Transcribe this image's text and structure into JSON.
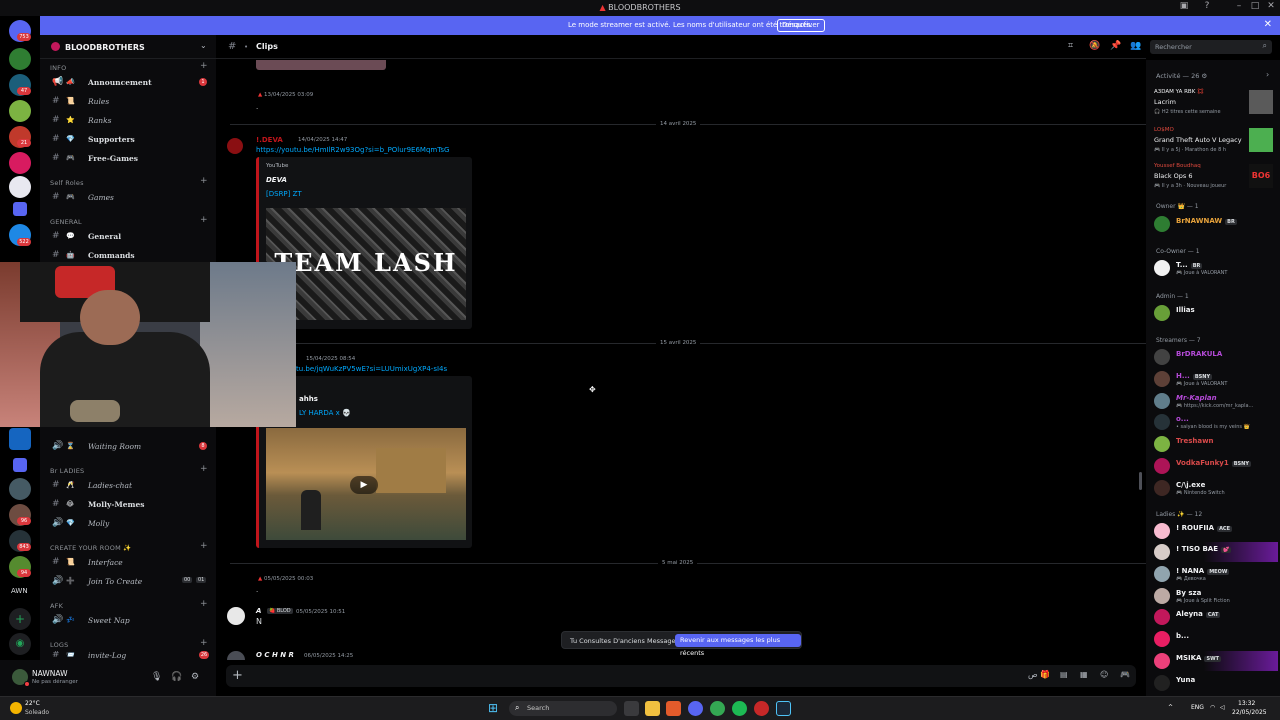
{
  "window": {
    "title": "BLOODBROTHERS"
  },
  "banner": {
    "text": "Le mode streamer est activé. Les noms d'utilisateur ont été tronqués.",
    "button": "Désactiver"
  },
  "rail": {
    "badges": [
      "753",
      "47",
      "21",
      "522",
      "96",
      "843",
      "94"
    ],
    "bottom_label": "AWN"
  },
  "server": {
    "name": "BLOODBROTHERS"
  },
  "sidebar": {
    "categories": {
      "info": "INFO",
      "self_roles": "Self Roles",
      "general": "GENERAL",
      "br_ladies": "Br LADIES",
      "create_room": "CREATE YOUR ROOM ✨",
      "afk": "AFK",
      "logs": "LOGS"
    },
    "channels": {
      "announcement": "Announcement",
      "rules": "Rules",
      "ranks": "Ranks",
      "supporters": "Supporters",
      "free_games": "Free-Games",
      "games": "Games",
      "general": "General",
      "commands": "Commands",
      "waiting_room": "Waiting Room",
      "ladies_chat": "Ladies-chat",
      "molly_memes": "Molly-Memes",
      "molly": "Molly",
      "interface": "Interface",
      "join_to_create": "Join To Create",
      "sweet_nap": "Sweet Nap",
      "invite_log": "invite-Log"
    },
    "badges": {
      "announcement": "1",
      "waiting_room": "8",
      "join_a": "00",
      "join_b": "01",
      "invite_log": "26"
    }
  },
  "user": {
    "name": "NAWNAW",
    "status": "Ne pas déranger"
  },
  "chat": {
    "channel": "Clips",
    "search_placeholder": "Rechercher",
    "msg1": {
      "time": "13/04/2025 03:09",
      "text": "."
    },
    "day1": "14 avril 2025",
    "msg2": {
      "author": "!.DEVA",
      "time": "14/04/2025 14:47",
      "link": "https://youtu.be/HmIlR2w93Og?si=b_POlur9E6MqmTsG",
      "provider": "YouTube",
      "embed_author": "DEVA",
      "embed_title": "[DSRP] ZT",
      "thumb_text": "TEAM LASH"
    },
    "day2": "15 avril 2025",
    "msg3": {
      "time": "15/04/2025 08:54",
      "link": "tu.be/jqWuKzPV5wE?si=LUUmixUgXP4-sI4s",
      "embed_author": "ahhs",
      "embed_title": "LY HARDA x 💀"
    },
    "day3": "5 mai 2025",
    "msg4": {
      "time": "05/05/2025 00:03",
      "text": "."
    },
    "msg5": {
      "author": "A",
      "tag": "BLOD",
      "time": "05/05/2025 10:51",
      "text": "N"
    },
    "msg6": {
      "author": "O C H N R",
      "time": "06/05/2025 14:25"
    },
    "jump": {
      "text": "Tu Consultes D'anciens Messages",
      "button": "Revenir aux messages les plus récents"
    }
  },
  "members": {
    "activity_title": "Activité — 26 ⚙",
    "activities": [
      {
        "who": "A3DAM YA RBK 💢",
        "what": "Lacrim",
        "sub": "🎧 H2 titres cette semaine"
      },
      {
        "who": "LO$MO",
        "what": "Grand Theft Auto V Legacy",
        "sub": "🎮 Il y a 5j · Marathon de 8 h"
      },
      {
        "who": "Youssef Boudhaq",
        "what": "Black Ops 6",
        "sub": "🎮 Il y a 3h · Nouveau joueur"
      }
    ],
    "groups": [
      {
        "label": "Owner 👑 — 1"
      },
      {
        "label": "Co-Owner — 1"
      },
      {
        "label": "Admin — 1"
      },
      {
        "label": "Streamers — 7"
      },
      {
        "label": "Ladies ✨ — 12"
      }
    ],
    "list": [
      {
        "name": "BrNAWNAW",
        "tag": "BR",
        "sub": "",
        "color": "#e8a33b"
      },
      {
        "name": "T...",
        "tag": "BR",
        "sub": "🎮 Joue à VALORANT",
        "color": "#f2f3f5"
      },
      {
        "name": "Illias",
        "tag": "",
        "sub": "",
        "color": "#f2f3f5"
      },
      {
        "name": "BrDRAKULA",
        "tag": "",
        "sub": "",
        "color": "#b54ad8"
      },
      {
        "name": "H...",
        "tag": "BSNY",
        "sub": "🎮 Joue à VALORANT",
        "color": "#b54ad8"
      },
      {
        "name": "Mr-Kaplan",
        "tag": "",
        "sub": "🎮 https://kick.com/mr_kapla...",
        "color": "#b54ad8"
      },
      {
        "name": "o...",
        "tag": "",
        "sub": "• saiyan blood is my veins 👑",
        "color": "#b54ad8"
      },
      {
        "name": "Treshawn",
        "tag": "",
        "sub": "",
        "color": "#d94a4a"
      },
      {
        "name": "VodkaFunky1",
        "tag": "BSNY",
        "sub": "",
        "color": "#d94a4a"
      },
      {
        "name": "C/\\j.exe",
        "tag": "",
        "sub": "🎮 Nintendo Switch",
        "color": "#f2f3f5"
      },
      {
        "name": "! ROUFIIA",
        "tag": "ACE",
        "sub": "",
        "color": "#f2f3f5"
      },
      {
        "name": "! TISO BAE",
        "tag": "💕",
        "sub": "",
        "color": "#f2f3f5"
      },
      {
        "name": "! NANA",
        "tag": "MEOW",
        "sub": "🎮 Девочка",
        "color": "#f2f3f5"
      },
      {
        "name": "By sza",
        "tag": "",
        "sub": "🎮 Joue à Split Fiction",
        "color": "#f2f3f5"
      },
      {
        "name": "Aleyna",
        "tag": "CAT",
        "sub": "",
        "color": "#f2f3f5"
      },
      {
        "name": "b...",
        "tag": "",
        "sub": "",
        "color": "#f2f3f5"
      },
      {
        "name": "MSIKA",
        "tag": "SWT",
        "sub": "",
        "color": "#f2f3f5"
      },
      {
        "name": "Yuna",
        "tag": "",
        "sub": "",
        "color": "#f2f3f5"
      }
    ]
  },
  "taskbar": {
    "weather_temp": "22°C",
    "weather_desc": "Soleado",
    "search": "Search",
    "lang": "ENG",
    "time": "13:32",
    "date": "22/05/2025"
  }
}
